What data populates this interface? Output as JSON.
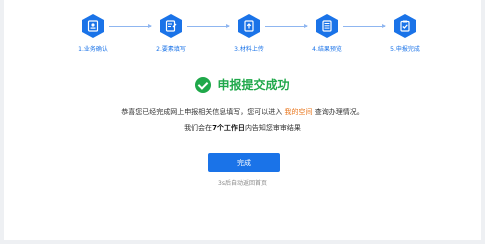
{
  "steps": [
    {
      "label": "1.业务确认",
      "icon": "id-card-icon"
    },
    {
      "label": "2.要素填写",
      "icon": "form-edit-icon"
    },
    {
      "label": "3.材料上传",
      "icon": "file-upload-icon"
    },
    {
      "label": "4.结果预览",
      "icon": "document-preview-icon"
    },
    {
      "label": "5.申报完成",
      "icon": "check-clipboard-icon"
    }
  ],
  "colors": {
    "accent": "#1a73e8",
    "success": "#1fa84a",
    "link": "#e8741a"
  },
  "result": {
    "title": "申报提交成功",
    "line1_before": "恭喜您已经完成网上申报相关信息填写，您可以进入",
    "line1_link": "我的空间",
    "line1_after": "查询办理情况。",
    "line2_before": "我们会在",
    "line2_bold": "7个工作日",
    "line2_after": "内告知您审审结果"
  },
  "done_button": "完成",
  "redirect_text": "3s后自动返回首页"
}
